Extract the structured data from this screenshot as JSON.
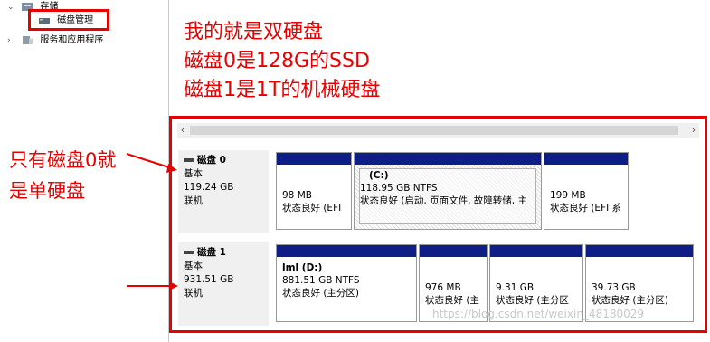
{
  "tree": {
    "items": [
      {
        "label": "存储",
        "expand": "⌄"
      },
      {
        "label": "磁盘管理",
        "expand": ""
      },
      {
        "label": "服务和应用程序",
        "expand": "›"
      }
    ]
  },
  "annotations": {
    "top_lines": [
      "我的就是双硬盘",
      "磁盘0是128G的SSD",
      "磁盘1是1T的机械硬盘"
    ],
    "left_lines": [
      "只有磁盘0就",
      "是单硬盘"
    ]
  },
  "scrollbar": {
    "left": "‹",
    "right": "›"
  },
  "disks": [
    {
      "name": "磁盘 0",
      "type": "基本",
      "size": "119.24 GB",
      "status": "联机",
      "partitions": [
        {
          "volume": "",
          "size": "98 MB",
          "status": "状态良好 (EFI"
        },
        {
          "volume": "(C:)",
          "size": "118.95 GB NTFS",
          "status": "状态良好 (启动, 页面文件, 故障转储, 主"
        },
        {
          "volume": "",
          "size": "199 MB",
          "status": "状态良好 (EFI 系"
        }
      ]
    },
    {
      "name": "磁盘 1",
      "type": "基本",
      "size": "931.51 GB",
      "status": "联机",
      "partitions": [
        {
          "volume": "lml  (D:)",
          "size": "881.51 GB NTFS",
          "status": "状态良好 (主分区)"
        },
        {
          "volume": "",
          "size": "976 MB",
          "status": "状态良好 (主"
        },
        {
          "volume": "",
          "size": "9.31 GB",
          "status": "状态良好 (主分区"
        },
        {
          "volume": "",
          "size": "39.73 GB",
          "status": "状态良好 (主分区)"
        }
      ]
    }
  ],
  "watermark": "https://blog.csdn.net/weixin_48180029",
  "colors": {
    "accent_red": "#e60000",
    "partition_bar": "#0f1e87"
  }
}
